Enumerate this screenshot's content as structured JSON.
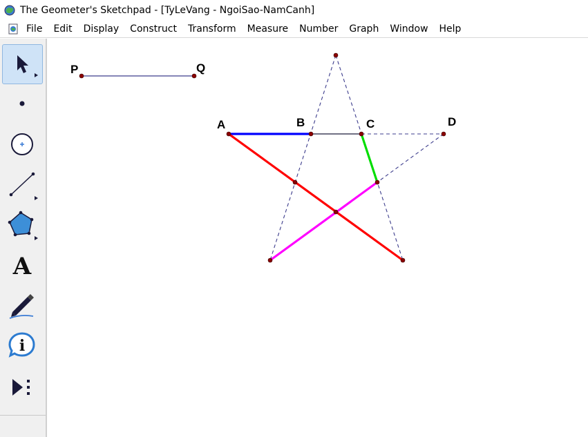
{
  "window": {
    "title": "The Geometer's Sketchpad - [TyLeVang - NgoiSao-NamCanh]"
  },
  "menu": {
    "items": [
      "File",
      "Edit",
      "Display",
      "Construct",
      "Transform",
      "Measure",
      "Number",
      "Graph",
      "Window",
      "Help"
    ]
  },
  "toolbox": {
    "tools": [
      {
        "name": "selection-arrow-tool-icon",
        "selected": true
      },
      {
        "name": "point-tool-icon"
      },
      {
        "name": "compass-tool-icon"
      },
      {
        "name": "straightedge-tool-icon"
      },
      {
        "name": "polygon-tool-icon"
      },
      {
        "name": "text-tool-icon",
        "glyph": "A"
      },
      {
        "name": "marker-tool-icon"
      },
      {
        "name": "information-tool-icon",
        "glyph": "i"
      },
      {
        "name": "custom-tool-icon"
      }
    ]
  },
  "sketch": {
    "labels": {
      "P": "P",
      "Q": "Q",
      "A": "A",
      "B": "B",
      "C": "C",
      "D": "D"
    },
    "colors": {
      "segment_AB": "#0000ff",
      "segment_C_green": "#00dd00",
      "red_line": "#ff0000",
      "magenta_line": "#ff00ff",
      "dashed": "#3c3c8c",
      "segment_PQ": "#3c3c8c",
      "point": "#8b0000"
    }
  }
}
